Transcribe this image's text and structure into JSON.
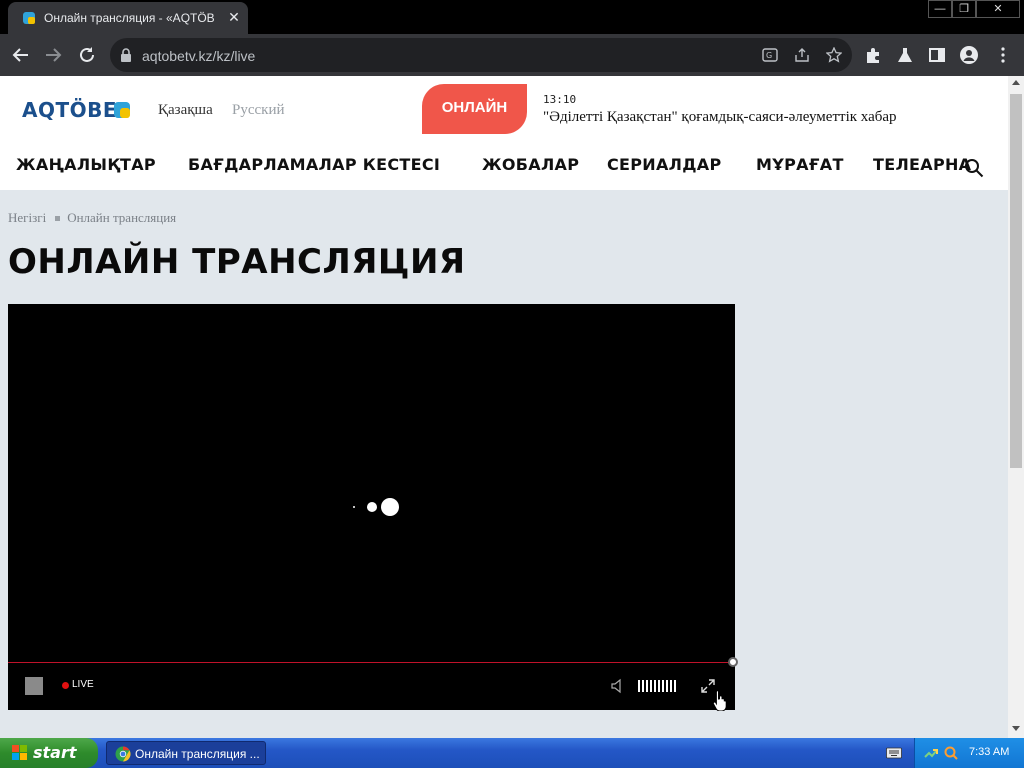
{
  "browser": {
    "tab_title": "Онлайн трансляция - «AQTÖBE» телеарнасы",
    "tab_close": "✕",
    "url": "aqtobetv.kz/kz/live",
    "window_controls": {
      "minimize": "—",
      "maximize": "❐",
      "close": "✕"
    }
  },
  "site": {
    "logo": "AQTÖBE",
    "lang_kz": "Қазақша",
    "lang_ru": "Русский",
    "online_button": "ОНЛАЙН",
    "now_playing": {
      "time": "13:10",
      "title": "\"Әділетті Қазақстан\" қоғамдық-саяси-әлеуметтік хабар"
    },
    "nav": [
      "ЖАҢАЛЫҚТАР",
      "БАҒДАРЛАМАЛАР КЕСТЕСІ",
      "ЖОБАЛАР",
      "СЕРИАЛДАР",
      "МҰРАҒАТ",
      "ТЕЛЕАРНА"
    ],
    "breadcrumb": {
      "home": "Негізгі",
      "current": "Онлайн трансляция"
    },
    "page_title": "ОНЛАЙН ТРАНСЛЯЦИЯ",
    "player": {
      "live_label": "LIVE",
      "accent_color": "#c0122a"
    }
  },
  "taskbar": {
    "start_label": "start",
    "task_label": "Онлайн трансляция ...",
    "clock": "7:33 AM"
  }
}
